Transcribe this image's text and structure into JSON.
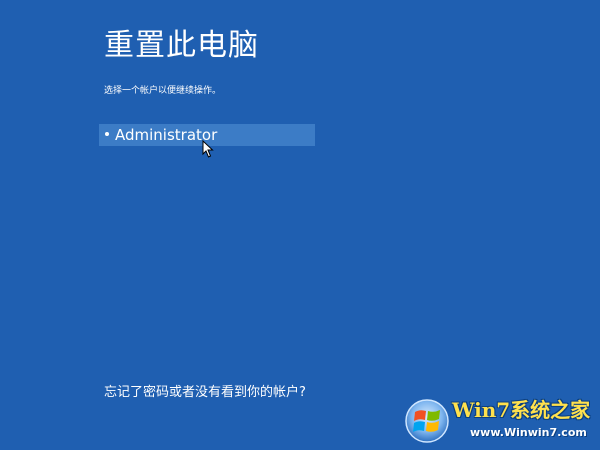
{
  "screen": {
    "title": "重置此电脑",
    "subtitle": "选择一个帐户以便继续操作。",
    "forgot_link": "忘记了密码或者没有看到你的帐户?",
    "background_color": "#1f5fb1"
  },
  "accounts": [
    {
      "name": "Administrator",
      "selected": true
    }
  ],
  "watermark": {
    "brand": "Win7系统之家",
    "url": "www.Winwin7.com"
  }
}
